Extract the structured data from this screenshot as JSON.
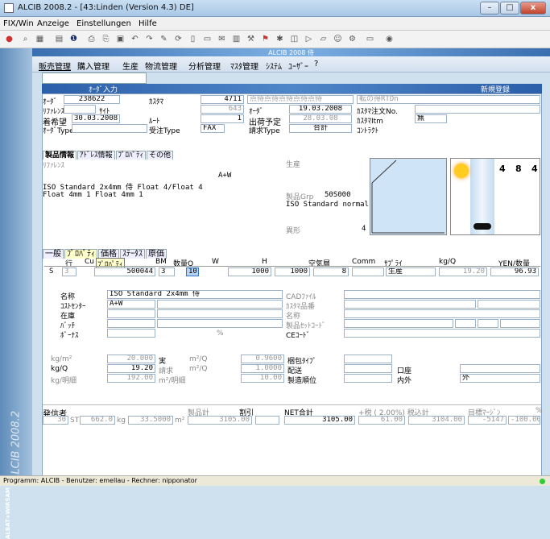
{
  "window": {
    "title": "ALCIB 2008.2 - [43:Linden (Version 4.3) DE]",
    "min": "–",
    "max": "□",
    "close": "x"
  },
  "menu": [
    "FIX/Win",
    "Anzeige",
    "Einstellungen",
    "Hilfe"
  ],
  "app": {
    "banner": "ALCIB 2008 侍",
    "menu": [
      "販売管理",
      "購入管理",
      "生産",
      "物流管理",
      "分析管理",
      "ﾏｽﾀ管理",
      "ｼｽﾃﾑ",
      "ﾕｰｻﾞｰ",
      "?"
    ],
    "brand": "ALCIB 2008.2",
    "brand2": "ALBAT+WIRSAM"
  },
  "form": {
    "title": "ｵｰﾀﾞ入力",
    "new_label": "新規登録",
    "row1": {
      "order_lbl": "ｵｰﾀﾞ",
      "order": "238622",
      "customer_lbl": "ｶｽﾀﾏ",
      "customer": "4711",
      "dots": "点待点待点待点待点待",
      "transfer": "転の得RTDn"
    },
    "row2": {
      "ref_lbl": "ﾘﾌｧﾚﾝｽ",
      "site_lbl": "ｻｲﾄ",
      "site": "643",
      "order_lbl": "ｵｰﾀﾞ",
      "order_date": "19.03.2008",
      "cust_order_lbl": "ｶｽﾀﾏ注文No."
    },
    "row3": {
      "wish_lbl": "着希望",
      "wish_date": "30.03.2008",
      "route_lbl": "ﾙｰﾄ",
      "route": "1",
      "ship_lbl": "出荷予定",
      "ship_date": "28.03.08",
      "cust_item_lbl": "ｶｽﾀﾏItm",
      "cust_item": "無"
    },
    "row4": {
      "type_lbl": "ｵｰﾀﾞType",
      "recv_lbl": "受注Type",
      "recv": "FAX",
      "bill_lbl": "請求Type",
      "bill": "合計",
      "contract_lbl": "ｺﾝﾄﾗｸﾄ"
    }
  },
  "tabs1": [
    "製品情報",
    "ｱﾄﾞﾚｽ情報",
    "ﾌﾟﾛﾊﾟﾃｨ",
    "その他"
  ],
  "product": {
    "ref_lbl": "ﾘﾌｧﾚﾝｽ",
    "code": "A+W",
    "line1": "ISO Standard 2x4mm 侍     Float 4/Float 4",
    "line2": "  Float       4mm    1  Float        4mm     1",
    "prod_lbl": "生産",
    "grp_lbl": "製品Grp",
    "grp": "50S000",
    "grp_desc": "ISO Standard normal",
    "shape_lbl": "異形",
    "shape": "4",
    "img_nums": [
      "4",
      "8",
      "4"
    ]
  },
  "tabs2": [
    "一般",
    "ﾌﾟﾛﾊﾟﾃｨ",
    "価格",
    "ｽﾃｰﾀｽ",
    "原価"
  ],
  "pos": {
    "headers": [
      "行",
      "Cu",
      "ﾌﾟﾛﾊﾟﾃｨ",
      "BM",
      "数量Q",
      "W",
      "H",
      "空気層",
      "Comm",
      "ｻﾌﾟﾗｲ",
      "kg/Q",
      "YEN/数量"
    ],
    "row": [
      "S",
      "3",
      "",
      "500044",
      "3",
      "10",
      "1000",
      "1000",
      "8",
      "",
      "生産",
      "19.20",
      "96.93"
    ]
  },
  "detail": {
    "name_lbl": "名称",
    "name": "ISO Standard 2x4mm 侍",
    "cost_lbl": "ｺｽﾄｾﾝﾀｰ",
    "cost": "A+W",
    "stock_lbl": "在庫",
    "batch_lbl": "ﾊﾞｯﾁ",
    "bonus_lbl": "ﾎﾞｰﾅｽ",
    "pct": "%",
    "cad_lbl": "CADﾌｧｲﾙ",
    "cust_item_lbl": "ｶｽﾀﾏ品番",
    "name2_lbl": "名称",
    "setcode_lbl": "製品ｾｯﾄｺｰﾄﾞ",
    "ce_lbl": "CEｺｰﾄﾞ"
  },
  "weights": {
    "kgm2_lbl": "kg/m²",
    "kgm2": "20.000",
    "real_lbl": "実",
    "m2q_lbl": "m²/Q",
    "m2q": "0.9600",
    "pack_lbl": "梱包ﾀｲﾌﾟ",
    "kgq_lbl": "kg/Q",
    "kgq": "19.20",
    "bill_lbl": "請求",
    "m2q2_lbl": "m²/Q",
    "m2q2": "1.0000",
    "ship_lbl": "配送",
    "acct_lbl": "口座",
    "kgd_lbl": "kg/明細",
    "kgd": "192.00",
    "m2d_lbl": "m²/明細",
    "m2d": "10.00",
    "prodorder_lbl": "製造順位",
    "inout_lbl": "内外",
    "inout": "外"
  },
  "footer": {
    "sender_lbl": "発信者",
    "qty": "30",
    "st": "ST",
    "kg": "662.0",
    "kg_lbl": "kg",
    "m2": "33.5000",
    "m2_lbl": "m²",
    "prod_total_lbl": "製品計",
    "prod_total": "3105.00",
    "disc_lbl": "割引",
    "net_lbl": "NET合計",
    "net": "3105.00",
    "tax_lbl": "+税 ( 2.00%) 税込計",
    "tax": "61.00",
    "gross": "3104.00",
    "margin_lbl": "目標ﾏｰｼﾞﾝ",
    "pct": "%",
    "margin": "-5147",
    "margin_pct": "-100.00"
  },
  "status": "Programm: ALCIB - Benutzer: emellau - Rechner: nipponator"
}
